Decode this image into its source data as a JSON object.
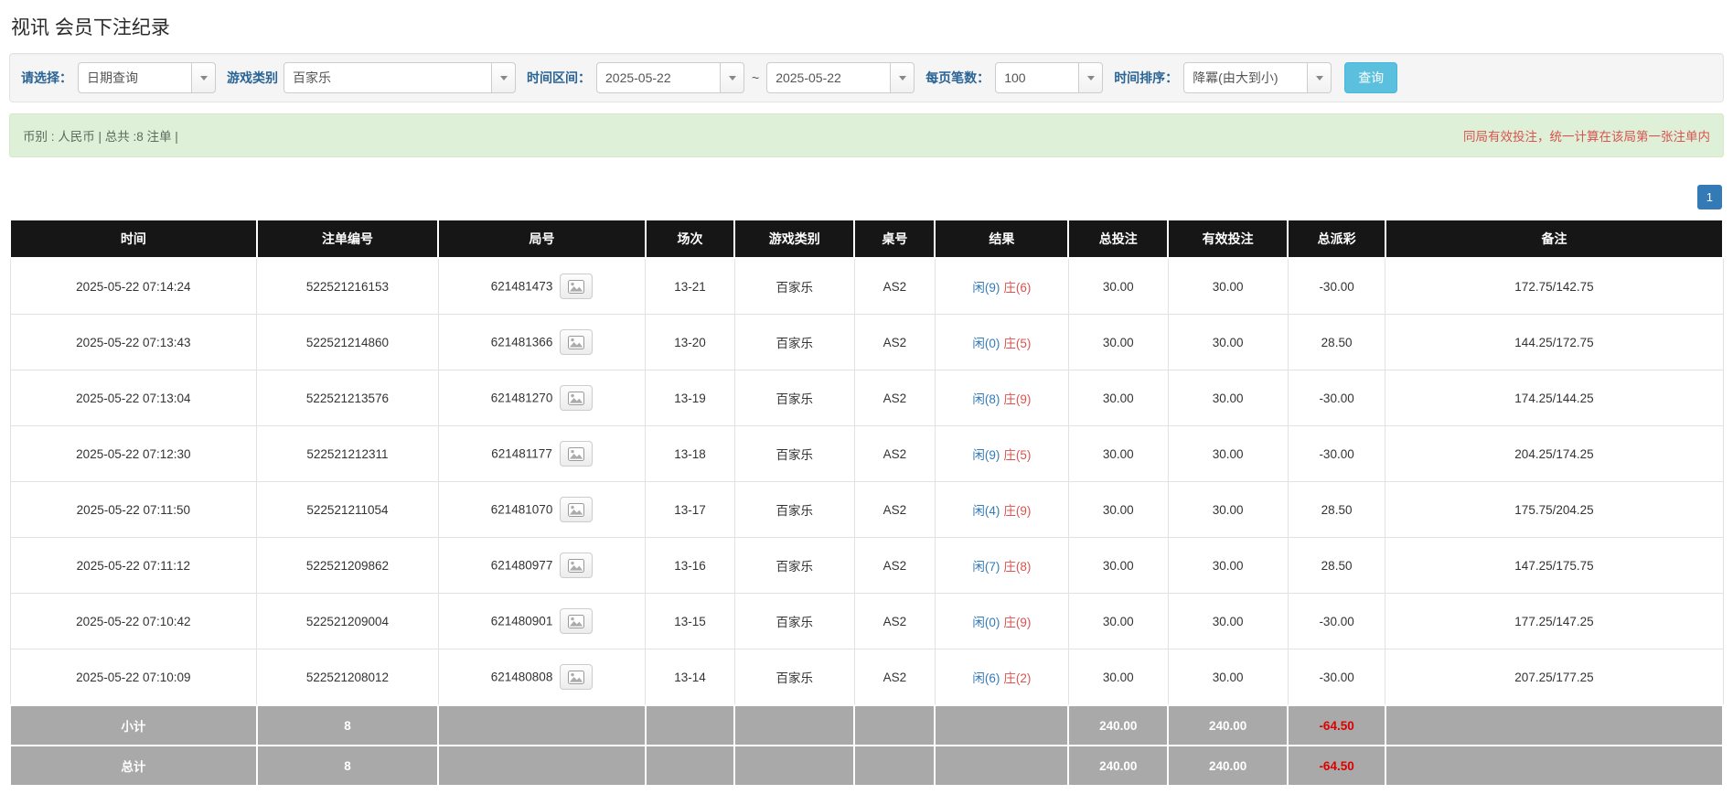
{
  "page": {
    "title": "视讯 会员下注纪录"
  },
  "filters": {
    "select_label": "请选择：",
    "select_value": "日期查询",
    "game_label": "游戏类别",
    "game_value": "百家乐",
    "range_label": "时间区间：",
    "date_from": "2025-05-22",
    "range_separator": "~",
    "date_to": "2025-05-22",
    "page_size_label": "每页笔数：",
    "page_size_value": "100",
    "sort_label": "时间排序：",
    "sort_value": "降冪(由大到小)",
    "query_button": "查询"
  },
  "info_bar": {
    "summary": "币别 : 人民币 | 总共 :8 注单 |",
    "notice": "同局有效投注，统一计算在该局第一张注单内"
  },
  "pagination": {
    "current": "1"
  },
  "table": {
    "headers": [
      "时间",
      "注单编号",
      "局号",
      "场次",
      "游戏类别",
      "桌号",
      "结果",
      "总投注",
      "有效投注",
      "总派彩",
      "备注"
    ],
    "rows": [
      {
        "time": "2025-05-22 07:14:24",
        "bet_id": "522521216153",
        "round_id": "621481473",
        "session": "13-21",
        "game": "百家乐",
        "table_no": "AS2",
        "result_player": "闲(9)",
        "result_banker": "庄(6)",
        "total_bet": "30.00",
        "valid_bet": "30.00",
        "payout": "-30.00",
        "note": "172.75/142.75"
      },
      {
        "time": "2025-05-22 07:13:43",
        "bet_id": "522521214860",
        "round_id": "621481366",
        "session": "13-20",
        "game": "百家乐",
        "table_no": "AS2",
        "result_player": "闲(0)",
        "result_banker": "庄(5)",
        "total_bet": "30.00",
        "valid_bet": "30.00",
        "payout": "28.50",
        "note": "144.25/172.75"
      },
      {
        "time": "2025-05-22 07:13:04",
        "bet_id": "522521213576",
        "round_id": "621481270",
        "session": "13-19",
        "game": "百家乐",
        "table_no": "AS2",
        "result_player": "闲(8)",
        "result_banker": "庄(9)",
        "total_bet": "30.00",
        "valid_bet": "30.00",
        "payout": "-30.00",
        "note": "174.25/144.25"
      },
      {
        "time": "2025-05-22 07:12:30",
        "bet_id": "522521212311",
        "round_id": "621481177",
        "session": "13-18",
        "game": "百家乐",
        "table_no": "AS2",
        "result_player": "闲(9)",
        "result_banker": "庄(5)",
        "total_bet": "30.00",
        "valid_bet": "30.00",
        "payout": "-30.00",
        "note": "204.25/174.25"
      },
      {
        "time": "2025-05-22 07:11:50",
        "bet_id": "522521211054",
        "round_id": "621481070",
        "session": "13-17",
        "game": "百家乐",
        "table_no": "AS2",
        "result_player": "闲(4)",
        "result_banker": "庄(9)",
        "total_bet": "30.00",
        "valid_bet": "30.00",
        "payout": "28.50",
        "note": "175.75/204.25"
      },
      {
        "time": "2025-05-22 07:11:12",
        "bet_id": "522521209862",
        "round_id": "621480977",
        "session": "13-16",
        "game": "百家乐",
        "table_no": "AS2",
        "result_player": "闲(7)",
        "result_banker": "庄(8)",
        "total_bet": "30.00",
        "valid_bet": "30.00",
        "payout": "28.50",
        "note": "147.25/175.75"
      },
      {
        "time": "2025-05-22 07:10:42",
        "bet_id": "522521209004",
        "round_id": "621480901",
        "session": "13-15",
        "game": "百家乐",
        "table_no": "AS2",
        "result_player": "闲(0)",
        "result_banker": "庄(9)",
        "total_bet": "30.00",
        "valid_bet": "30.00",
        "payout": "-30.00",
        "note": "177.25/147.25"
      },
      {
        "time": "2025-05-22 07:10:09",
        "bet_id": "522521208012",
        "round_id": "621480808",
        "session": "13-14",
        "game": "百家乐",
        "table_no": "AS2",
        "result_player": "闲(6)",
        "result_banker": "庄(2)",
        "total_bet": "30.00",
        "valid_bet": "30.00",
        "payout": "-30.00",
        "note": "207.25/177.25"
      }
    ],
    "subtotal": {
      "label": "小计",
      "count": "8",
      "total_bet": "240.00",
      "valid_bet": "240.00",
      "payout": "-64.50"
    },
    "grand_total": {
      "label": "总计",
      "count": "8",
      "total_bet": "240.00",
      "valid_bet": "240.00",
      "payout": "-64.50"
    }
  },
  "colors": {
    "label_blue": "#2a6496",
    "link_blue": "#337ab7",
    "player_blue": "#337ab7",
    "banker_red": "#d9534f",
    "negative_red": "#dd0000",
    "notice_red": "#d9534f",
    "button_teal": "#5bc0de",
    "button_teal_border": "#46b8da",
    "header_bg": "#161616",
    "summary_bg": "#a9a9a9",
    "info_bg": "#dff0d8",
    "info_border": "#d6e9c6",
    "filter_bg": "#f5f5f5",
    "filter_border": "#e3e3e3"
  }
}
